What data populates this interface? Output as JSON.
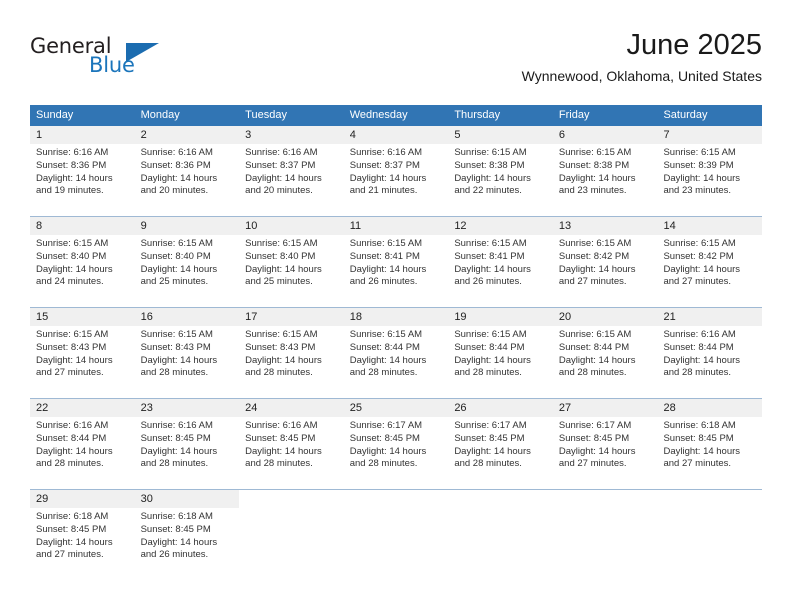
{
  "brand": {
    "word_one": "General",
    "word_two": "Blue",
    "triangle_icon": "triangle-icon",
    "accent_blue": "#1b75bb"
  },
  "header": {
    "title": "June 2025",
    "subtitle": "Wynnewood, Oklahoma, United States"
  },
  "calendar": {
    "header_color": "#3175b4",
    "band_color": "#f0f0f0",
    "weekdays": [
      "Sunday",
      "Monday",
      "Tuesday",
      "Wednesday",
      "Thursday",
      "Friday",
      "Saturday"
    ],
    "weeks": [
      [
        {
          "day": "1",
          "sunrise": "Sunrise: 6:16 AM",
          "sunset": "Sunset: 8:36 PM",
          "daylight": "Daylight: 14 hours and 19 minutes."
        },
        {
          "day": "2",
          "sunrise": "Sunrise: 6:16 AM",
          "sunset": "Sunset: 8:36 PM",
          "daylight": "Daylight: 14 hours and 20 minutes."
        },
        {
          "day": "3",
          "sunrise": "Sunrise: 6:16 AM",
          "sunset": "Sunset: 8:37 PM",
          "daylight": "Daylight: 14 hours and 20 minutes."
        },
        {
          "day": "4",
          "sunrise": "Sunrise: 6:16 AM",
          "sunset": "Sunset: 8:37 PM",
          "daylight": "Daylight: 14 hours and 21 minutes."
        },
        {
          "day": "5",
          "sunrise": "Sunrise: 6:15 AM",
          "sunset": "Sunset: 8:38 PM",
          "daylight": "Daylight: 14 hours and 22 minutes."
        },
        {
          "day": "6",
          "sunrise": "Sunrise: 6:15 AM",
          "sunset": "Sunset: 8:38 PM",
          "daylight": "Daylight: 14 hours and 23 minutes."
        },
        {
          "day": "7",
          "sunrise": "Sunrise: 6:15 AM",
          "sunset": "Sunset: 8:39 PM",
          "daylight": "Daylight: 14 hours and 23 minutes."
        }
      ],
      [
        {
          "day": "8",
          "sunrise": "Sunrise: 6:15 AM",
          "sunset": "Sunset: 8:40 PM",
          "daylight": "Daylight: 14 hours and 24 minutes."
        },
        {
          "day": "9",
          "sunrise": "Sunrise: 6:15 AM",
          "sunset": "Sunset: 8:40 PM",
          "daylight": "Daylight: 14 hours and 25 minutes."
        },
        {
          "day": "10",
          "sunrise": "Sunrise: 6:15 AM",
          "sunset": "Sunset: 8:40 PM",
          "daylight": "Daylight: 14 hours and 25 minutes."
        },
        {
          "day": "11",
          "sunrise": "Sunrise: 6:15 AM",
          "sunset": "Sunset: 8:41 PM",
          "daylight": "Daylight: 14 hours and 26 minutes."
        },
        {
          "day": "12",
          "sunrise": "Sunrise: 6:15 AM",
          "sunset": "Sunset: 8:41 PM",
          "daylight": "Daylight: 14 hours and 26 minutes."
        },
        {
          "day": "13",
          "sunrise": "Sunrise: 6:15 AM",
          "sunset": "Sunset: 8:42 PM",
          "daylight": "Daylight: 14 hours and 27 minutes."
        },
        {
          "day": "14",
          "sunrise": "Sunrise: 6:15 AM",
          "sunset": "Sunset: 8:42 PM",
          "daylight": "Daylight: 14 hours and 27 minutes."
        }
      ],
      [
        {
          "day": "15",
          "sunrise": "Sunrise: 6:15 AM",
          "sunset": "Sunset: 8:43 PM",
          "daylight": "Daylight: 14 hours and 27 minutes."
        },
        {
          "day": "16",
          "sunrise": "Sunrise: 6:15 AM",
          "sunset": "Sunset: 8:43 PM",
          "daylight": "Daylight: 14 hours and 28 minutes."
        },
        {
          "day": "17",
          "sunrise": "Sunrise: 6:15 AM",
          "sunset": "Sunset: 8:43 PM",
          "daylight": "Daylight: 14 hours and 28 minutes."
        },
        {
          "day": "18",
          "sunrise": "Sunrise: 6:15 AM",
          "sunset": "Sunset: 8:44 PM",
          "daylight": "Daylight: 14 hours and 28 minutes."
        },
        {
          "day": "19",
          "sunrise": "Sunrise: 6:15 AM",
          "sunset": "Sunset: 8:44 PM",
          "daylight": "Daylight: 14 hours and 28 minutes."
        },
        {
          "day": "20",
          "sunrise": "Sunrise: 6:15 AM",
          "sunset": "Sunset: 8:44 PM",
          "daylight": "Daylight: 14 hours and 28 minutes."
        },
        {
          "day": "21",
          "sunrise": "Sunrise: 6:16 AM",
          "sunset": "Sunset: 8:44 PM",
          "daylight": "Daylight: 14 hours and 28 minutes."
        }
      ],
      [
        {
          "day": "22",
          "sunrise": "Sunrise: 6:16 AM",
          "sunset": "Sunset: 8:44 PM",
          "daylight": "Daylight: 14 hours and 28 minutes."
        },
        {
          "day": "23",
          "sunrise": "Sunrise: 6:16 AM",
          "sunset": "Sunset: 8:45 PM",
          "daylight": "Daylight: 14 hours and 28 minutes."
        },
        {
          "day": "24",
          "sunrise": "Sunrise: 6:16 AM",
          "sunset": "Sunset: 8:45 PM",
          "daylight": "Daylight: 14 hours and 28 minutes."
        },
        {
          "day": "25",
          "sunrise": "Sunrise: 6:17 AM",
          "sunset": "Sunset: 8:45 PM",
          "daylight": "Daylight: 14 hours and 28 minutes."
        },
        {
          "day": "26",
          "sunrise": "Sunrise: 6:17 AM",
          "sunset": "Sunset: 8:45 PM",
          "daylight": "Daylight: 14 hours and 28 minutes."
        },
        {
          "day": "27",
          "sunrise": "Sunrise: 6:17 AM",
          "sunset": "Sunset: 8:45 PM",
          "daylight": "Daylight: 14 hours and 27 minutes."
        },
        {
          "day": "28",
          "sunrise": "Sunrise: 6:18 AM",
          "sunset": "Sunset: 8:45 PM",
          "daylight": "Daylight: 14 hours and 27 minutes."
        }
      ],
      [
        {
          "day": "29",
          "sunrise": "Sunrise: 6:18 AM",
          "sunset": "Sunset: 8:45 PM",
          "daylight": "Daylight: 14 hours and 27 minutes."
        },
        {
          "day": "30",
          "sunrise": "Sunrise: 6:18 AM",
          "sunset": "Sunset: 8:45 PM",
          "daylight": "Daylight: 14 hours and 26 minutes."
        },
        null,
        null,
        null,
        null,
        null
      ]
    ]
  }
}
